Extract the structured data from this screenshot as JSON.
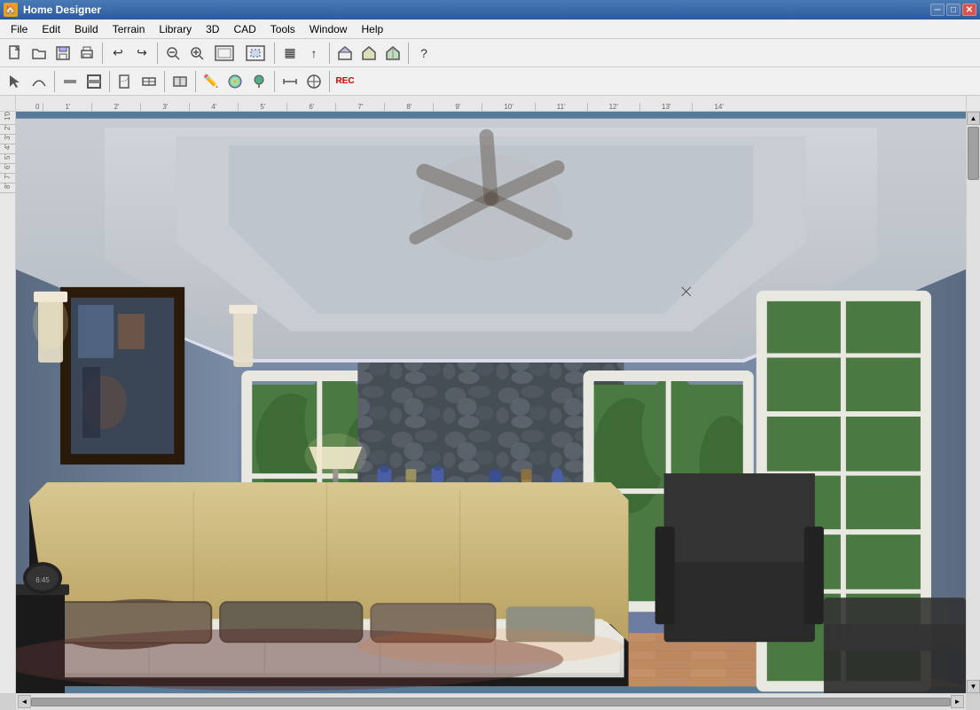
{
  "titleBar": {
    "title": "Home Designer",
    "icon": "🏠",
    "controls": {
      "minimize": "─",
      "maximize": "□",
      "close": "✕"
    }
  },
  "menuBar": {
    "items": [
      "File",
      "Edit",
      "Build",
      "Terrain",
      "Library",
      "3D",
      "CAD",
      "Tools",
      "Window",
      "Help"
    ]
  },
  "toolbar1": {
    "buttons": [
      {
        "name": "new",
        "icon": "📄"
      },
      {
        "name": "open",
        "icon": "📁"
      },
      {
        "name": "save",
        "icon": "💾"
      },
      {
        "name": "print",
        "icon": "🖨"
      },
      {
        "name": "undo",
        "icon": "↩"
      },
      {
        "name": "redo",
        "icon": "↪"
      },
      {
        "name": "zoom-out",
        "icon": "🔍"
      },
      {
        "name": "zoom-in",
        "icon": "🔎"
      },
      {
        "name": "zoom-fit",
        "icon": "⊞"
      },
      {
        "name": "zoom-selection",
        "icon": "⊡"
      },
      {
        "name": "fill",
        "icon": "▦"
      },
      {
        "name": "arrow-up",
        "icon": "↑"
      },
      {
        "name": "house",
        "icon": "⌂"
      },
      {
        "name": "question",
        "icon": "?"
      }
    ]
  },
  "toolbar2": {
    "buttons": [
      {
        "name": "select",
        "icon": "↖"
      },
      {
        "name": "draw-line",
        "icon": "⌒"
      },
      {
        "name": "wall",
        "icon": "▭"
      },
      {
        "name": "door",
        "icon": "⊞"
      },
      {
        "name": "window",
        "icon": "⊟"
      },
      {
        "name": "stair",
        "icon": "⊠"
      },
      {
        "name": "cabinet",
        "icon": "⊡"
      },
      {
        "name": "paint",
        "icon": "✏"
      },
      {
        "name": "material",
        "icon": "◈"
      },
      {
        "name": "plant",
        "icon": "❀"
      },
      {
        "name": "dimension",
        "icon": "↔"
      },
      {
        "name": "transform",
        "icon": "⊕"
      },
      {
        "name": "rec",
        "icon": "⏺"
      }
    ]
  },
  "scene": {
    "type": "3D bedroom render",
    "description": "Modern bedroom with fireplace, stone wall, French doors, and windows"
  },
  "scrollbar": {
    "vertical": {
      "up": "▲",
      "down": "▼"
    },
    "horizontal": {
      "left": "◄",
      "right": "►"
    }
  }
}
